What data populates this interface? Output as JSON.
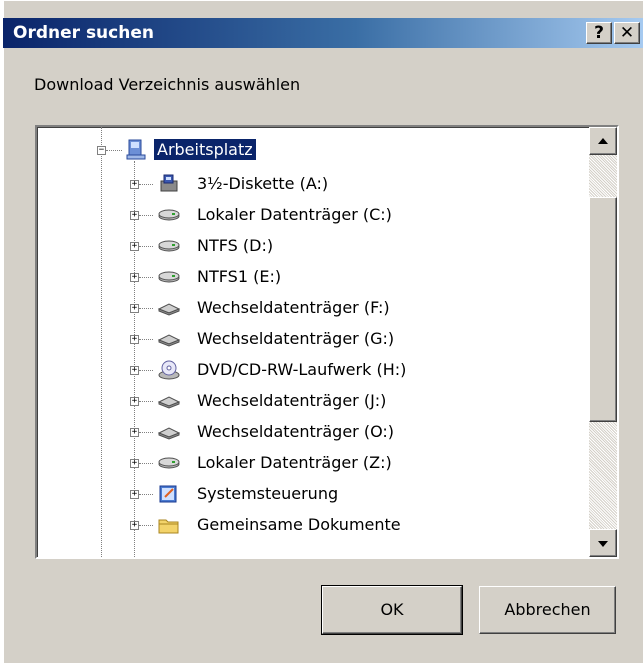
{
  "window": {
    "title": "Ordner suchen",
    "help_label": "?",
    "close_label": "✕"
  },
  "prompt": "Download Verzeichnis auswählen",
  "tree": {
    "root": {
      "label": "Arbeitsplatz",
      "icon": "computer-icon",
      "expanded": true,
      "selected": true
    },
    "items": [
      {
        "label": "3½-Diskette (A:)",
        "icon": "floppy-drive-icon"
      },
      {
        "label": "Lokaler Datenträger (C:)",
        "icon": "hard-drive-icon"
      },
      {
        "label": "NTFS (D:)",
        "icon": "hard-drive-icon"
      },
      {
        "label": "NTFS1 (E:)",
        "icon": "hard-drive-icon"
      },
      {
        "label": "Wechseldatenträger (F:)",
        "icon": "removable-drive-icon"
      },
      {
        "label": "Wechseldatenträger (G:)",
        "icon": "removable-drive-icon"
      },
      {
        "label": "DVD/CD-RW-Laufwerk (H:)",
        "icon": "cd-drive-icon"
      },
      {
        "label": "Wechseldatenträger (J:)",
        "icon": "removable-drive-icon"
      },
      {
        "label": "Wechseldatenträger (O:)",
        "icon": "removable-drive-icon"
      },
      {
        "label": "Lokaler Datenträger (Z:)",
        "icon": "hard-drive-icon"
      },
      {
        "label": "Systemsteuerung",
        "icon": "control-panel-icon"
      },
      {
        "label": "Gemeinsame Dokumente",
        "icon": "folder-icon"
      }
    ]
  },
  "buttons": {
    "ok": "OK",
    "cancel": "Abbrechen"
  },
  "colors": {
    "titlebar_start": "#0a246a",
    "titlebar_end": "#a6caf0",
    "dialog_face": "#d4d0c8",
    "selection": "#0a246a"
  }
}
